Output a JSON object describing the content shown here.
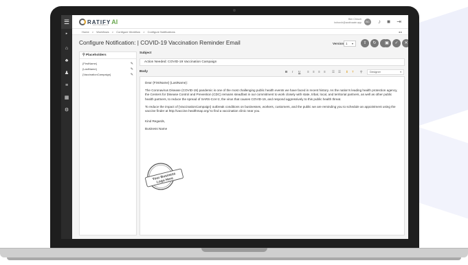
{
  "app": {
    "logo_main": "RATIFY",
    "logo_ai": "AI",
    "logo_tag": "your Compliance"
  },
  "user": {
    "name": "Ben Chruch",
    "email": "bchurch@acctivaate.app",
    "initials": "BC"
  },
  "rail": {
    "items": [
      "home-icon",
      "users-icon",
      "sitemap-icon",
      "list-icon",
      "chart-icon",
      "cogs-icon"
    ]
  },
  "breadcrumb": [
    "Home",
    ">",
    "Workflows",
    ">",
    "Configure Workflow",
    ">",
    "Configure Notifications"
  ],
  "page": {
    "title": "Configure Notification: | COVID-19 Vaccination Reminder Email",
    "title_fade": "",
    "version_label": "Version",
    "version_value": "1"
  },
  "placeholders": {
    "header": "Placeholders",
    "items": [
      "{FirstName}",
      "{LastName}",
      "{VaccinationCampaign}"
    ]
  },
  "subject": {
    "label": "Subject",
    "value": "Action Needed: COVID-19 Vaccination Campaign"
  },
  "body": {
    "label": "Body",
    "toolbar": {
      "bold": "B",
      "italic": "I",
      "underline": "U",
      "designer": "Designer"
    },
    "greeting": "Dear {FirstName} {LastName}:",
    "p1": "The Coronavirus Disease (COVID-19) pandemic is one of the most challenging public health events we have faced in recent history. As the nation's leading health protection agency, the Centers for Disease Control and Prevention (CDC) remains steadfast in our commitment to work closely with state, tribal, local, and territorial partners, as well as other public health partners, to reduce the spread of SARS-CoV-2, the virus that causes COVID-19, and respond aggressively to this public health threat.",
    "p2": "To reduce the impact of {VaccinationCampaign} outbreak conditions on businesses, workers, customers, and the public we are reminding you to schedule an appointment using the vaccine finder at http://vaccine.healthmap.org/ to find a vaccination clinic near you.",
    "closing": "Kind Regards,",
    "signature": "Business Name",
    "stamp_text": "Your Business Logo Here"
  },
  "colors": {
    "rail": "#2b2b2b",
    "bezel": "#1e1e1e",
    "button": "#777777"
  }
}
